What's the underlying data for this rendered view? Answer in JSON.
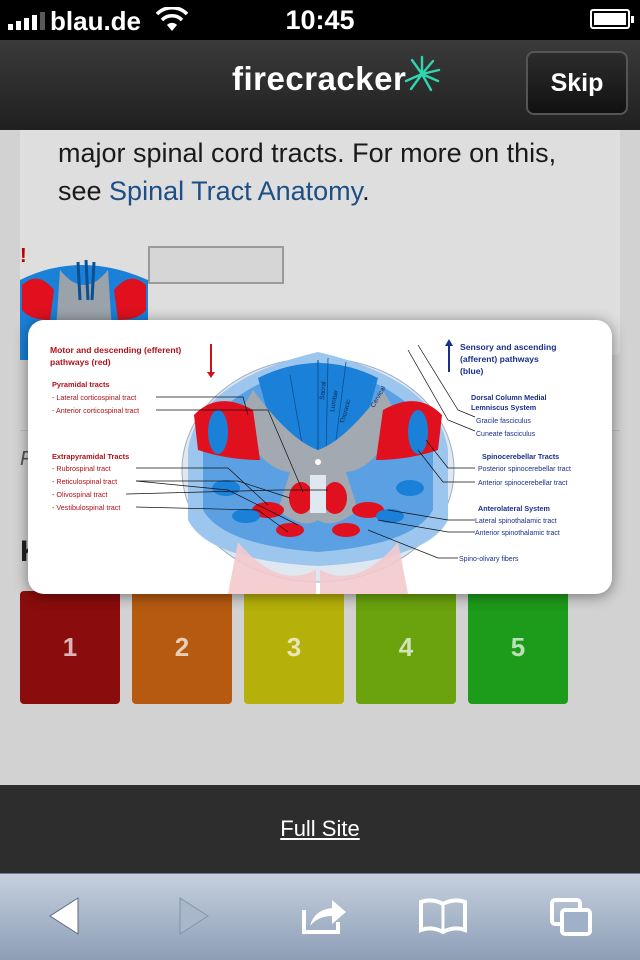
{
  "status_bar": {
    "carrier": "blau.de",
    "time": "10:45"
  },
  "header": {
    "brand": "firecracker",
    "skip_label": "Skip"
  },
  "content": {
    "intro_text": "major spinal cord tracts. For more on this, see ",
    "intro_link": "Spinal Tract Anatomy",
    "intro_end": ".",
    "ratings": [
      {
        "label": "1",
        "color": "#8a0c0c"
      },
      {
        "label": "2",
        "color": "#b55a10"
      },
      {
        "label": "3",
        "color": "#b5b00a"
      },
      {
        "label": "4",
        "color": "#6aa30e"
      },
      {
        "label": "5",
        "color": "#1d9b1a"
      }
    ]
  },
  "diagram": {
    "left_heading": "Motor and descending (efferent) pathways (red)",
    "pyramidal_heading": "Pyramidal tracts",
    "pyramidal_items": [
      "- Lateral corticospinal tract",
      "- Anterior corticospinal tract"
    ],
    "extrapyramidal_heading": "Extrapyramidal Tracts",
    "extrapyramidal_items": [
      "- Rubrospinal tract",
      "- Reticulospinal tract",
      "- Olivospinal tract",
      "- Vestibulospinal tract"
    ],
    "right_heading": "Sensory and ascending (afferent) pathways (blue)",
    "dorsal_heading": "Dorsal Column Medial Lemniscus System",
    "dorsal_items": [
      "Gracile fasciculus",
      "Cuneate fasciculus"
    ],
    "spinocerebellar_heading": "Spinocerebellar Tracts",
    "spinocerebellar_items": [
      "Posterior spinocerebellar tract",
      "Anterior spinocerebellar tract"
    ],
    "anterolateral_heading": "Anterolateral System",
    "anterolateral_items": [
      "Lateral spinothalamic tract",
      "Anterior spinothalamic tract"
    ],
    "spino_olivary": "Spino-olivary fibers",
    "segment_labels": [
      "Sacral",
      "Lumbar",
      "Thoracic",
      "Cervical"
    ],
    "colors": {
      "motor": "#e0101e",
      "sensory": "#1a80d8",
      "heading_red": "#b0101a",
      "heading_blue": "#1a2f8a"
    }
  },
  "footer": {
    "full_site": "Full Site"
  },
  "toolbar": {
    "icons": [
      "back-arrow-icon",
      "forward-arrow-icon",
      "share-icon",
      "bookmarks-icon",
      "tabs-icon"
    ]
  }
}
